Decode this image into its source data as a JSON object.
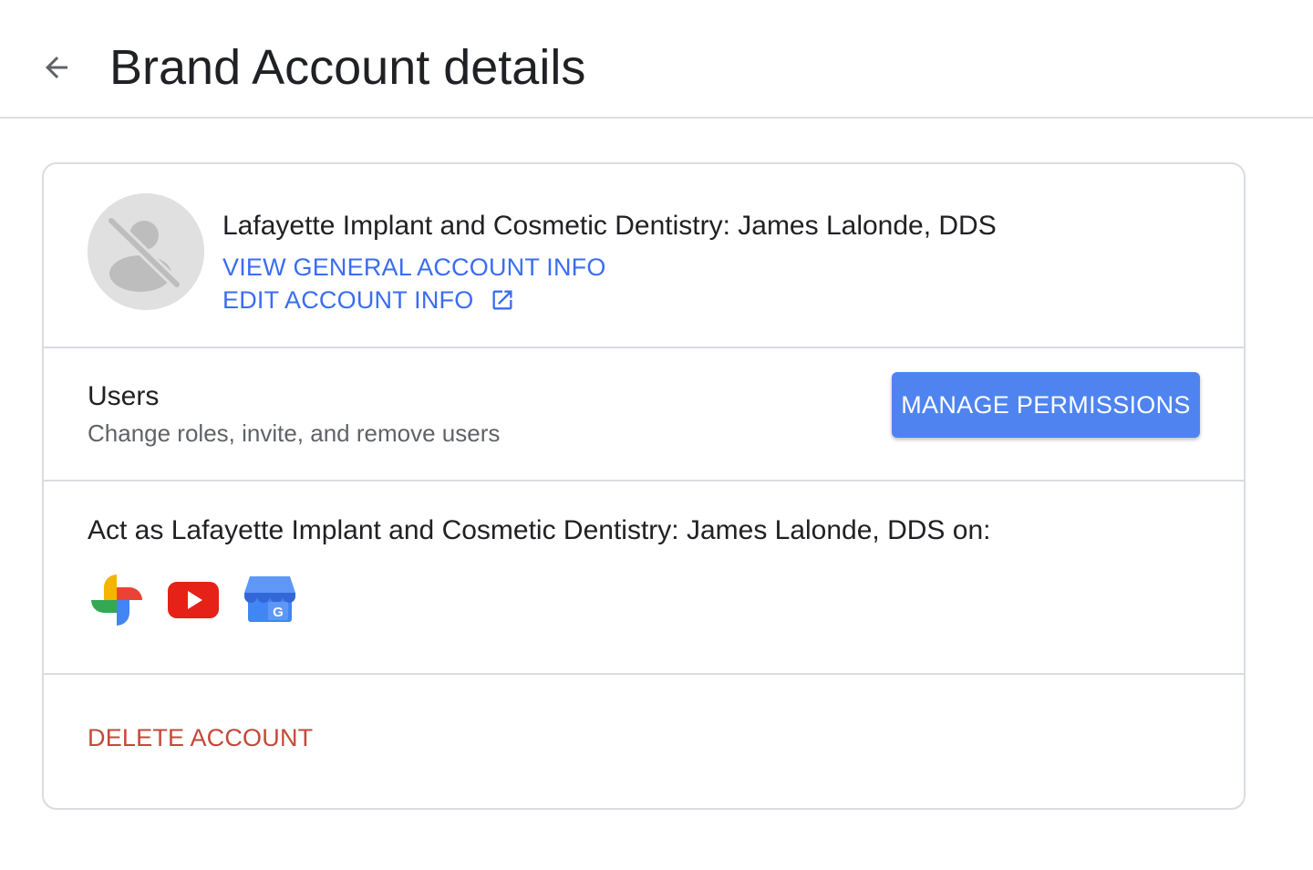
{
  "header": {
    "back_icon": "arrow-left-icon",
    "title": "Brand Account details"
  },
  "account": {
    "name": "Lafayette Implant and Cosmetic Dentistry: James Lalonde, DDS",
    "avatar_icon": "no-profile-photo-icon",
    "view_info_label": "VIEW GENERAL ACCOUNT INFO",
    "edit_info_label": "EDIT ACCOUNT INFO",
    "edit_info_icon": "open-in-new-icon",
    "link_color": "#3b6df0"
  },
  "users": {
    "title": "Users",
    "subtitle": "Change roles, invite, and remove users",
    "manage_button_label": "MANAGE PERMISSIONS",
    "button_color": "#4f84f0"
  },
  "act_as": {
    "label": "Act as Lafayette Implant and Cosmetic Dentistry: James Lalonde, DDS on:",
    "services": [
      {
        "name": "google-photos-icon"
      },
      {
        "name": "youtube-icon"
      },
      {
        "name": "google-my-business-icon"
      }
    ]
  },
  "danger": {
    "delete_label": "DELETE ACCOUNT",
    "color": "#c5483a"
  }
}
